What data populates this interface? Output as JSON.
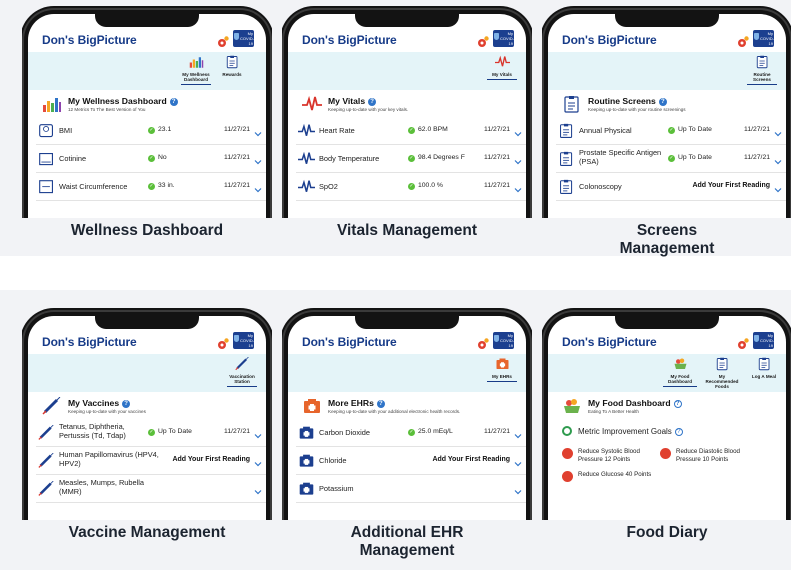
{
  "app_title": "Don's BigPicture",
  "covid_card": "My COVID-19 Card",
  "colors": {
    "brand": "#173b88",
    "band": "#e4f4f8",
    "ok": "#5bbf3a",
    "chevron": "#2f74c8"
  },
  "panels": [
    {
      "caption": "Wellness Dashboard",
      "tabs": [
        "My Wellness Dashboard",
        "Rewards"
      ],
      "title": "My Wellness Dashboard",
      "subtitle": "12 Metrics To The Best Version of You",
      "rows": [
        {
          "label": "BMI",
          "status": "23.1",
          "date": "11/27/21"
        },
        {
          "label": "Cotinine",
          "status": "No",
          "date": "11/27/21"
        },
        {
          "label": "Waist Circumference",
          "status": "33 in.",
          "date": "11/27/21"
        }
      ]
    },
    {
      "caption": "Vitals Management",
      "tabs": [
        "My Vitals"
      ],
      "title": "My Vitals",
      "subtitle": "Keeping up-to-date with your key vitals.",
      "rows": [
        {
          "label": "Heart Rate",
          "status": "62.0 BPM",
          "date": "11/27/21"
        },
        {
          "label": "Body Temperature",
          "status": "98.4 Degrees F",
          "date": "11/27/21"
        },
        {
          "label": "SpO2",
          "status": "100.0 %",
          "date": "11/27/21"
        }
      ]
    },
    {
      "caption": "Screens Management",
      "tabs": [
        "Routine Screens"
      ],
      "title": "Routine Screens",
      "subtitle": "Keeping up-to-date with your routine screenings",
      "rows": [
        {
          "label": "Annual Physical",
          "status": "Up To Date",
          "date": "11/27/21"
        },
        {
          "label": "Prostate Specific Antigen (PSA)",
          "status": "Up To Date",
          "date": "11/27/21"
        },
        {
          "label": "Colonoscopy",
          "add": "Add Your First Reading"
        }
      ]
    },
    {
      "caption": "Vaccine Management",
      "tabs": [
        "Vaccination Station"
      ],
      "title": "My Vaccines",
      "subtitle": "Keeping up-to-date with your vaccines",
      "rows": [
        {
          "label": "Tetanus, Diphtheria, Pertussis (Td, Tdap)",
          "status": "Up To Date",
          "date": "11/27/21"
        },
        {
          "label": "Human Papillomavirus (HPV4, HPV2)",
          "add": "Add Your First Reading"
        },
        {
          "label": "Measles, Mumps, Rubella (MMR)"
        }
      ]
    },
    {
      "caption": "Additional EHR Management",
      "tabs": [
        "My EHRs"
      ],
      "title": "More EHRs",
      "subtitle": "Keeping up-to-date with your additional electronic health records.",
      "rows": [
        {
          "label": "Carbon Dioxide",
          "status": "25.0 mEq/L",
          "date": "11/27/21"
        },
        {
          "label": "Chloride",
          "add": "Add Your First Reading"
        },
        {
          "label": "Potassium"
        }
      ]
    },
    {
      "caption": "Food Diary",
      "tabs": [
        "My Food Dashboard",
        "My Recommended Foods",
        "Log A Meal"
      ],
      "title": "My Food Dashboard",
      "subtitle": "Eating To A Better Health",
      "goals_title": "Metric Improvement Goals",
      "goals": [
        "Reduce Systolic Blood Pressure 12 Points",
        "Reduce Diastolic Blood Pressure 10 Points",
        "Reduce Glucose 40 Points"
      ]
    }
  ]
}
